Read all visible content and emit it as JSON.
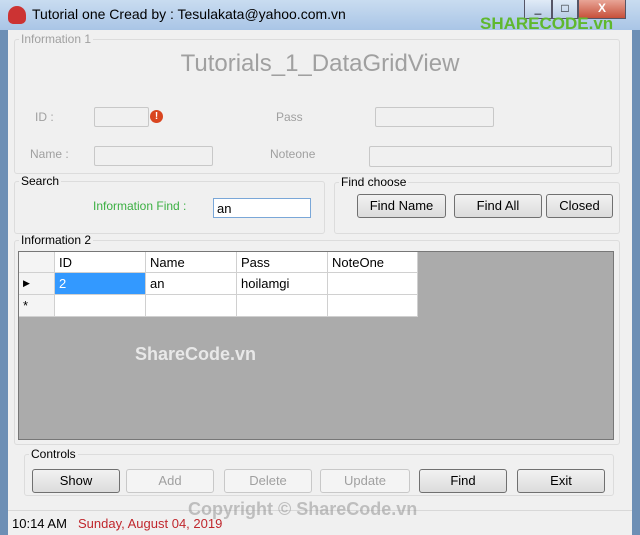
{
  "window": {
    "title": "Tutorial one Cread by : Tesulakata@yahoo.com.vn",
    "minimize": "_",
    "maximize": "□",
    "close": "X"
  },
  "watermarks": {
    "logo": "SHARECODE.vn",
    "grid": "ShareCode.vn",
    "copyright": "Copyright © ShareCode.vn"
  },
  "info1": {
    "legend": "Information 1",
    "heading": "Tutorials_1_DataGridView",
    "id_label": "ID :",
    "pass_label": "Pass",
    "name_label": "Name :",
    "noteone_label": "Noteone",
    "id_value": "",
    "pass_value": "",
    "name_value": "",
    "noteone_value": "",
    "error_icon": "error-icon"
  },
  "search": {
    "legend": "Search",
    "label": "Information Find :",
    "value": "an",
    "label_color": "#3cb043"
  },
  "find_choose": {
    "legend": "Find choose",
    "buttons": [
      "Find Name",
      "Find All",
      "Closed"
    ]
  },
  "info2": {
    "legend": "Information 2",
    "columns": [
      "ID",
      "Name",
      "Pass",
      "NoteOne"
    ],
    "rows": [
      [
        "2",
        "an",
        "hoilamgi",
        ""
      ]
    ],
    "new_row_marker": "*",
    "current_row_marker": "▶"
  },
  "controls": {
    "legend": "Controls",
    "buttons": [
      {
        "label": "Show",
        "enabled": true
      },
      {
        "label": "Add",
        "enabled": false
      },
      {
        "label": "Delete",
        "enabled": false
      },
      {
        "label": "Update",
        "enabled": false
      },
      {
        "label": "Find",
        "enabled": true
      },
      {
        "label": "Exit",
        "enabled": true
      }
    ]
  },
  "status": {
    "time": "10:14 AM",
    "date": "Sunday, August 04, 2019",
    "date_color": "#c0272d"
  }
}
